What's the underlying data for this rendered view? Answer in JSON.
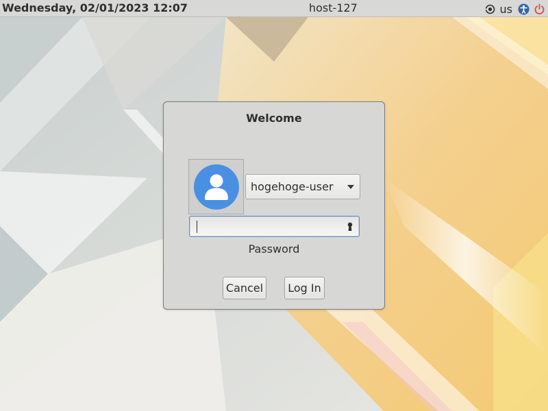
{
  "panel": {
    "clock": "Wednesday, 02/01/2023 12:07",
    "hostname": "host-127",
    "keyboard_layout": "us",
    "icons": [
      "network-icon",
      "accessibility-icon",
      "power-icon"
    ]
  },
  "dialog": {
    "title": "Welcome",
    "user": {
      "selected": "hogehoge-user",
      "avatar_icon": "user-avatar-icon"
    },
    "password": {
      "value": "",
      "label": "Password"
    },
    "buttons": {
      "cancel": "Cancel",
      "login": "Log In"
    }
  },
  "colors": {
    "panel_bg": "#d8d8d6",
    "dialog_bg": "#d7d7d6",
    "avatar_blue": "#4a90e2",
    "focus_border": "#5f8dc4",
    "power_red": "#e0443d",
    "accessibility_blue": "#3465a4"
  }
}
